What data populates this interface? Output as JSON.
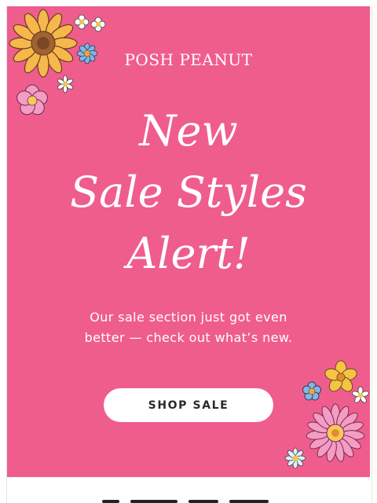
{
  "email": {
    "brand": "POSH PEANUT",
    "headline_lines": [
      "New",
      "Sale Styles",
      "Alert!"
    ],
    "subtext_lines": [
      "Our sale section just got even",
      "better — check out what’s new."
    ],
    "cta_label": "SHOP SALE"
  },
  "colors": {
    "hero_background": "#ef5d8d",
    "text": "#ffffff",
    "button_background": "#ffffff",
    "button_text": "#2a2a2a"
  },
  "decorations": {
    "top_left": [
      "sunflower-icon",
      "daisy-icon",
      "pink-flower-icon",
      "blue-flower-icon"
    ],
    "bottom_right": [
      "yellow-flower-icon",
      "blue-flower-icon",
      "pink-flower-icon",
      "daisy-icon"
    ]
  }
}
